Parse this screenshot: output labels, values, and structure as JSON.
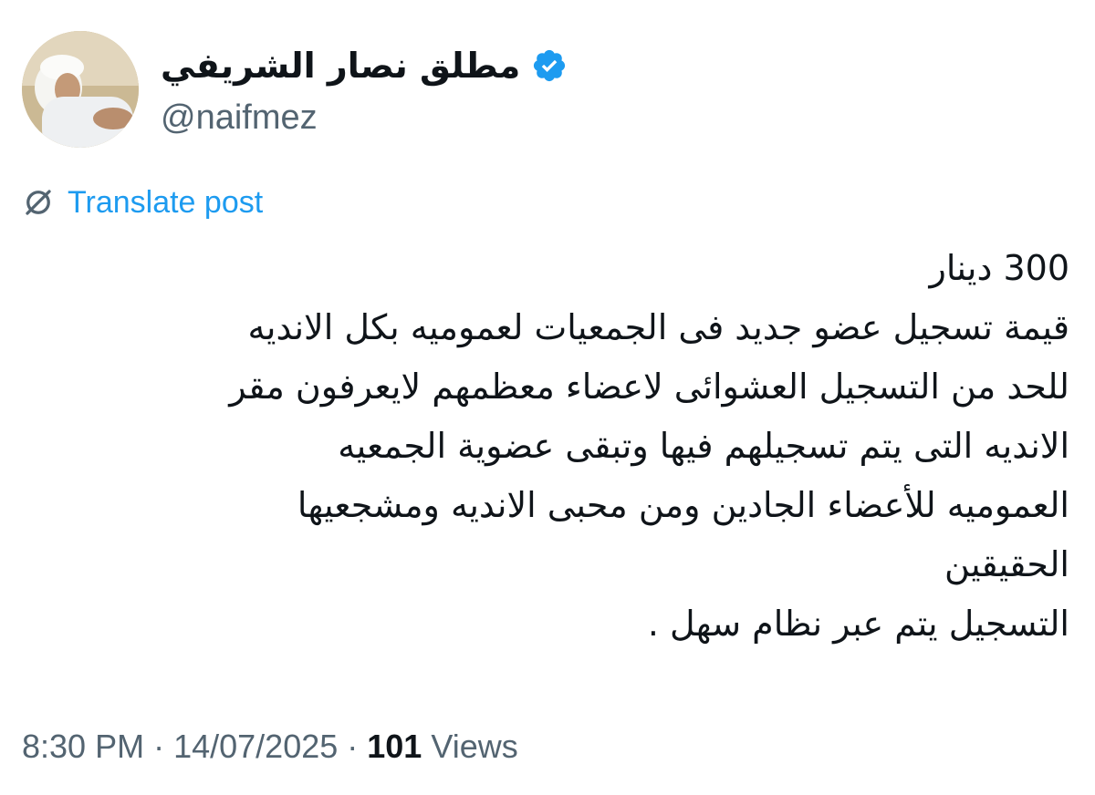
{
  "author": {
    "display_name": "مطلق نصار الشريفي",
    "handle": "@naifmez",
    "verified": true,
    "verified_color": "#1d9bf0"
  },
  "translate": {
    "label": "Translate post",
    "icon": "translate-icon"
  },
  "post": {
    "lines": [
      "300 دينار",
      "قيمة تسجيل عضو جديد فى الجمعيات لعموميه بكل الانديه",
      "للحد من التسجيل العشوائى لاعضاء معظمهم لايعرفون مقر",
      "الانديه التى يتم تسجيلهم فيها وتبقى عضوية الجمعيه",
      "العموميه للأعضاء الجادين ومن محبى الانديه  ومشجعيها",
      "الحقيقين",
      "التسجيل يتم عبر نظام سهل ."
    ]
  },
  "meta": {
    "time": "8:30 PM",
    "separator": "·",
    "date": "14/07/2025",
    "views_count": "101",
    "views_label": "Views"
  },
  "colors": {
    "link": "#1d9bf0",
    "secondary_text": "#536471",
    "primary_text": "#0f1419"
  }
}
